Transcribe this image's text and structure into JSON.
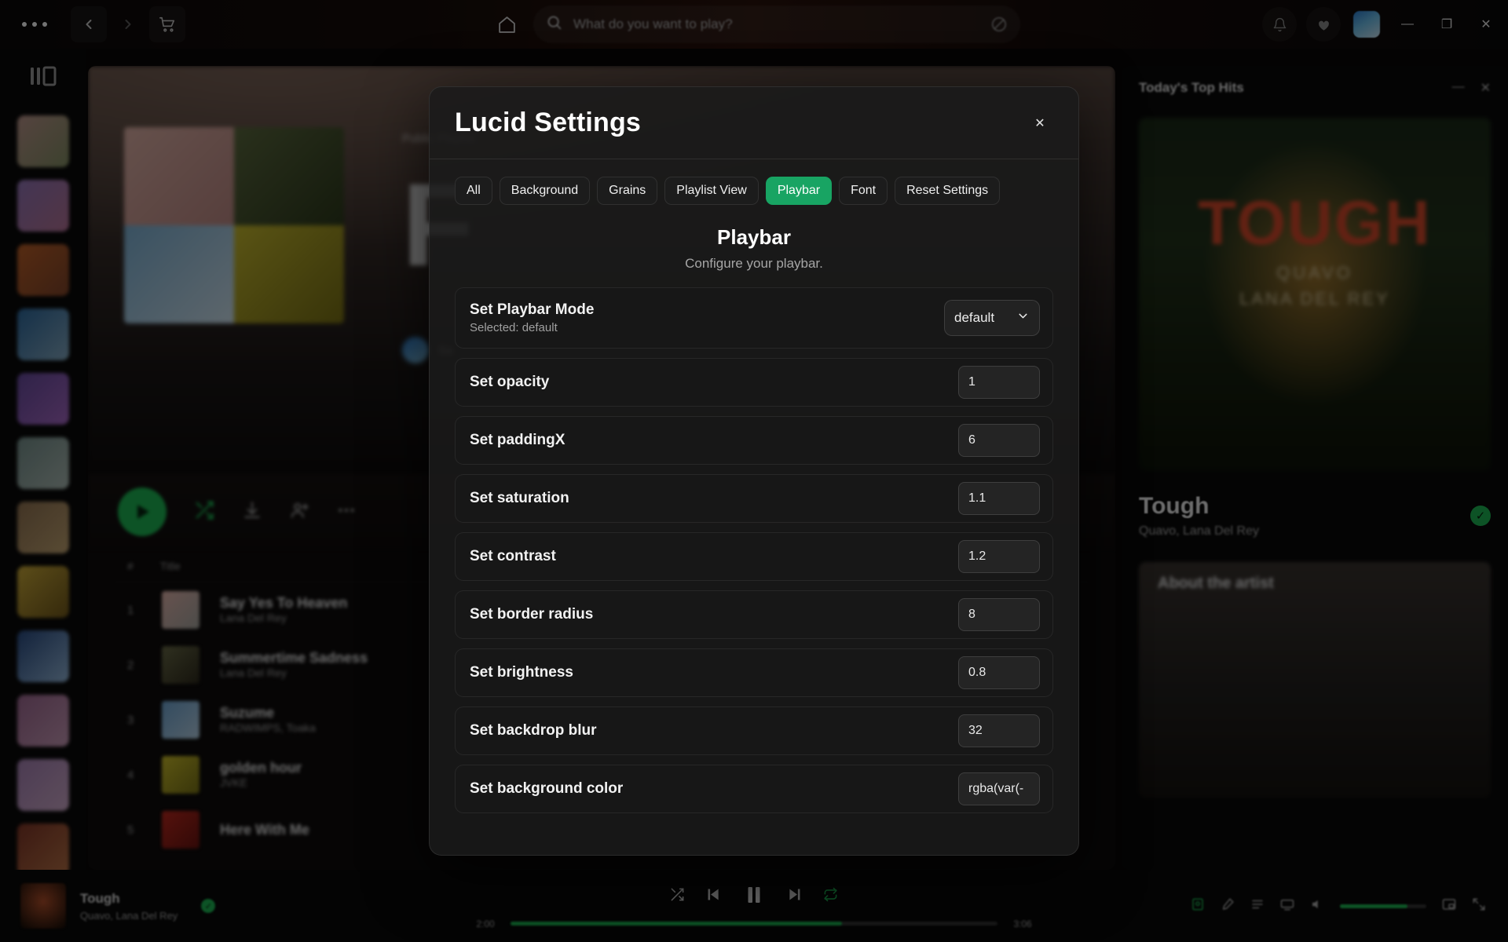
{
  "window": {
    "minimize_label": "—",
    "maximize_label": "❐",
    "close_label": "✕"
  },
  "topbar": {
    "overflow_label": "•••",
    "back_label": "‹",
    "forward_label": "›",
    "cart_icon": "shopping-cart-icon",
    "home_icon": "home-icon",
    "search_icon": "search-icon",
    "search_placeholder": "What do you want to play?",
    "browse_icon": "browse-icon",
    "notifications_icon": "bell-icon",
    "friends_icon": "friend-activity-icon",
    "avatar_label": ""
  },
  "rail": {
    "library_icon": "library-icon",
    "items": [
      {
        "name": "playlist-thumb-1",
        "color1": "#c79d94",
        "color2": "#8d9a6c"
      },
      {
        "name": "playlist-thumb-2",
        "color1": "#9b7ec4",
        "color2": "#c27aa0"
      },
      {
        "name": "playlist-thumb-3",
        "color1": "#c9662a",
        "color2": "#8a4a2c"
      },
      {
        "name": "playlist-thumb-4",
        "color1": "#2f6fa8",
        "color2": "#8fb6cf"
      },
      {
        "name": "playlist-thumb-5",
        "color1": "#6d4fa8",
        "color2": "#b06fd0"
      },
      {
        "name": "playlist-thumb-6",
        "color1": "#7e9a96",
        "color2": "#b9c9c2"
      },
      {
        "name": "playlist-thumb-7",
        "color1": "#9a7a57",
        "color2": "#d0b07a"
      },
      {
        "name": "playlist-thumb-8",
        "color1": "#d8b53c",
        "color2": "#7a5f1c"
      },
      {
        "name": "playlist-thumb-9",
        "color1": "#2b4f8a",
        "color2": "#9dc3e8"
      },
      {
        "name": "playlist-thumb-10",
        "color1": "#a86f9b",
        "color2": "#d6a6c4"
      },
      {
        "name": "playlist-thumb-11",
        "color1": "#b08ac0",
        "color2": "#ddb6d8"
      },
      {
        "name": "playlist-thumb-12",
        "color1": "#8a3a2a",
        "color2": "#c47a4a"
      }
    ]
  },
  "playlist": {
    "kicker": "Public Playlist",
    "title_fragment": "F",
    "owner": "Sa",
    "header_num": "#",
    "header_title": "Title",
    "tracks": [
      {
        "num": "1",
        "title": "Say Yes To Heaven",
        "artist": "Lana Del Rey",
        "c1": "#e5b6ad",
        "c2": "#a9a9a3"
      },
      {
        "num": "2",
        "title": "Summertime Sadness",
        "artist": "Lana Del Rey",
        "c1": "#6a6b47",
        "c2": "#2e2a1c"
      },
      {
        "num": "3",
        "title": "Suzume",
        "artist": "RADWIMPS, Toaka",
        "c1": "#6fa6d4",
        "c2": "#b9d4e8"
      },
      {
        "num": "4",
        "title": "golden hour",
        "artist": "JVKE",
        "c1": "#cdbf2a",
        "c2": "#7c7516"
      },
      {
        "num": "5",
        "title": "Here With Me",
        "artist": "",
        "c1": "#c0291e",
        "c2": "#6c1410"
      }
    ]
  },
  "right_panel": {
    "title": "Today's Top Hits",
    "minimize_icon": "minimize-icon",
    "close_icon": "close-icon",
    "cover_word": "TOUGH",
    "cover_sub1": "QUAVO",
    "cover_sub2": "LANA DEL REY",
    "song": "Tough",
    "artists": "Quavo, Lana Del Rey",
    "verified_icon": "verified-check-icon",
    "about_label": "About the artist"
  },
  "player": {
    "song": "Tough",
    "artists": "Quavo, Lana Del Rey",
    "saved_icon": "saved-check-icon",
    "shuffle_icon": "shuffle-icon",
    "previous_icon": "previous-track-icon",
    "pause_icon": "pause-icon",
    "next_icon": "next-track-icon",
    "repeat_icon": "repeat-icon",
    "elapsed": "2:00",
    "duration": "3:06",
    "progress_percent": 68,
    "now_playing_icon": "now-playing-view-icon",
    "lyrics_icon": "lyrics-icon",
    "queue_icon": "queue-icon",
    "devices_icon": "connect-device-icon",
    "volume_icon": "volume-icon",
    "volume_percent": 78,
    "miniplayer_icon": "miniplayer-icon",
    "fullscreen_icon": "fullscreen-icon"
  },
  "modal": {
    "title": "Lucid Settings",
    "close_label": "✕",
    "tabs": [
      {
        "label": "All",
        "active": false
      },
      {
        "label": "Background",
        "active": false
      },
      {
        "label": "Grains",
        "active": false
      },
      {
        "label": "Playlist View",
        "active": false
      },
      {
        "label": "Playbar",
        "active": true
      },
      {
        "label": "Font",
        "active": false
      },
      {
        "label": "Reset Settings",
        "active": false
      }
    ],
    "accent_color": "#18a463",
    "section": {
      "title": "Playbar",
      "subtitle": "Configure your playbar."
    },
    "mode_row": {
      "label": "Set Playbar Mode",
      "sublabel": "Selected: default",
      "value": "default",
      "chevron": "⌄"
    },
    "settings": [
      {
        "label": "Set opacity",
        "value": "1"
      },
      {
        "label": "Set paddingX",
        "value": "6"
      },
      {
        "label": "Set saturation",
        "value": "1.1"
      },
      {
        "label": "Set contrast",
        "value": "1.2"
      },
      {
        "label": "Set border radius",
        "value": "8"
      },
      {
        "label": "Set brightness",
        "value": "0.8"
      },
      {
        "label": "Set backdrop blur",
        "value": "32"
      },
      {
        "label": "Set background color",
        "value": "rgba(var(-"
      }
    ]
  }
}
